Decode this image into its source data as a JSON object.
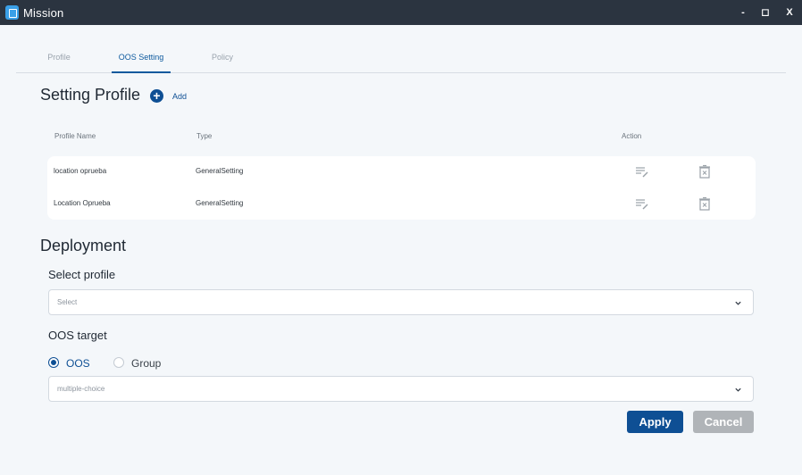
{
  "window": {
    "title": "Mission",
    "minimize": "-",
    "maximize": "◻",
    "close": "X"
  },
  "tabs": [
    {
      "label": "Profile"
    },
    {
      "label": "OOS Setting"
    },
    {
      "label": "Policy"
    }
  ],
  "setting_profile": {
    "title": "Setting Profile",
    "add_icon": "+",
    "add_label": "Add",
    "columns": {
      "name": "Profile Name",
      "type": "Type",
      "action": "Action"
    },
    "rows": [
      {
        "name": "location oprueba",
        "type": "GeneralSetting"
      },
      {
        "name": "Location Oprueba",
        "type": "GeneralSetting"
      }
    ]
  },
  "deployment": {
    "title": "Deployment",
    "select_profile": {
      "label": "Select profile",
      "placeholder": "Select"
    },
    "oos_target": {
      "label": "OOS target",
      "options": [
        {
          "label": "OOS",
          "checked": true
        },
        {
          "label": "Group",
          "checked": false
        }
      ],
      "placeholder": "multiple-choice"
    }
  },
  "buttons": {
    "apply": "Apply",
    "cancel": "Cancel"
  },
  "colors": {
    "accent": "#0e4f94",
    "titlebar": "#2b3440",
    "background": "#f4f7fa",
    "disabled_button": "#b0b4b8"
  },
  "icons": [
    "edit-icon",
    "delete-icon",
    "add-icon",
    "chevron-down-icon"
  ]
}
